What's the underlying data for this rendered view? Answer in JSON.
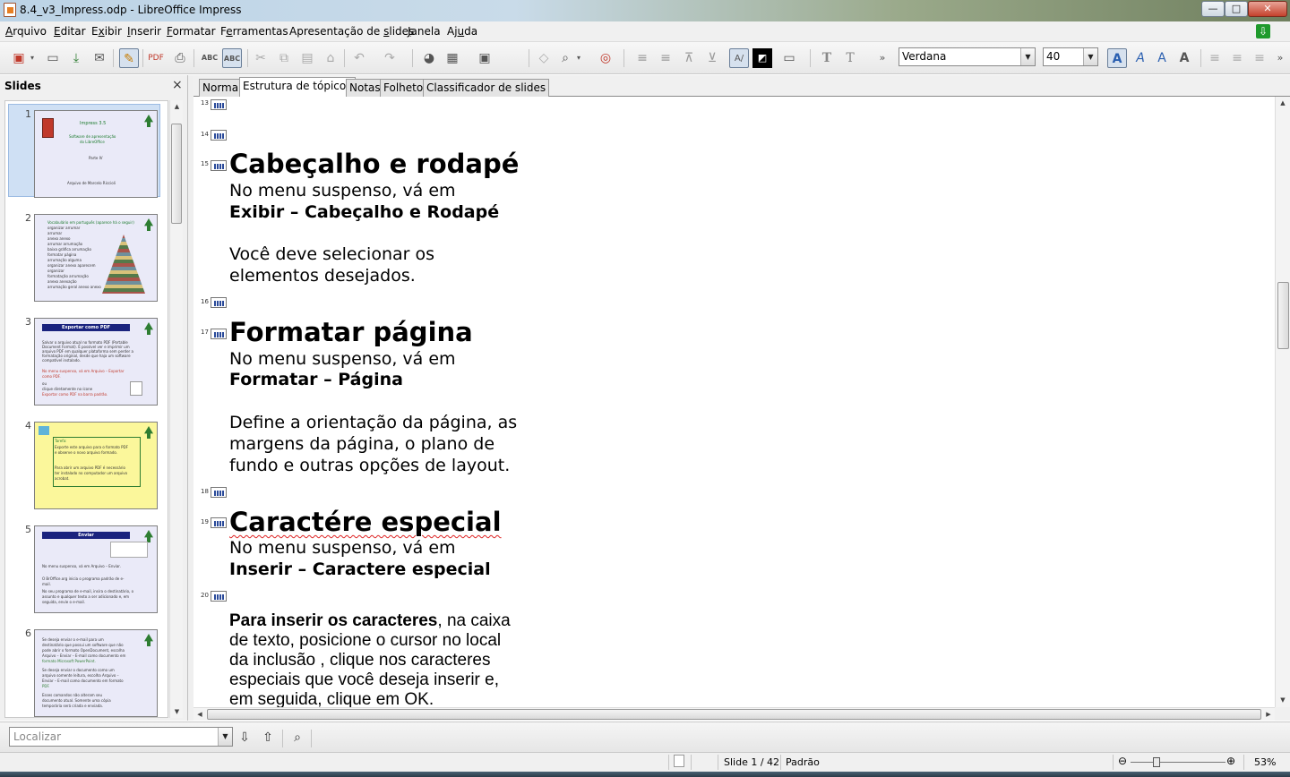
{
  "window": {
    "title": "8.4_v3_Impress.odp - LibreOffice Impress",
    "min_glyph": "—",
    "max_glyph": "□",
    "close_glyph": "✕"
  },
  "menu": [
    {
      "pre": "",
      "key": "A",
      "post": "rquivo"
    },
    {
      "pre": "",
      "key": "E",
      "post": "ditar"
    },
    {
      "pre": "E",
      "key": "x",
      "post": "ibir"
    },
    {
      "pre": "",
      "key": "I",
      "post": "nserir"
    },
    {
      "pre": "",
      "key": "F",
      "post": "ormatar"
    },
    {
      "pre": "F",
      "key": "e",
      "post": "rramentas"
    },
    {
      "pre": "Apresentação de ",
      "key": "s",
      "post": "lides"
    },
    {
      "pre": "",
      "key": "J",
      "post": "anela"
    },
    {
      "pre": "Aj",
      "key": "u",
      "post": "da"
    }
  ],
  "toolbar": {
    "font_name": "Verdana",
    "font_size": "40"
  },
  "slides_pane": {
    "title": "Slides",
    "close": "×",
    "slides": [
      {
        "num": "1",
        "bar": "",
        "lines": [
          "Impress 3.5",
          "Software de apresentação",
          "do LibreOffice",
          "Parte IV",
          "Arquivo de Marcelo Riccioli"
        ]
      },
      {
        "num": "2",
        "bar": "",
        "lines": [
          "Vocabulário em português (aparece há o seguir)",
          "organizar arrumar",
          "arrumar",
          "anexo anexo",
          "arrumar arrumação",
          "baixa gráfica arrumação",
          "formatar página",
          "arrumação alguma",
          "organizar anexo aparecem",
          "organizar",
          "formatação arrumação",
          "anexo anexação",
          "arrumação geral anexo anexo"
        ]
      },
      {
        "num": "3",
        "bar": "Exportar como PDF",
        "lines": [
          "Salvar o arquivo atual no formato PDF (Portable",
          "Document Format). É possível ver e imprimir um",
          "arquivo PDF em qualquer plataforma sem perder a",
          "formatação original, desde que haja um software",
          "compatível instalado.",
          "No menu suspenso, vá em Arquivo – Exportar",
          "como PDF.",
          "ou",
          "clique diretamente no ícone",
          "Exportar como PDF na barra padrão."
        ]
      },
      {
        "num": "4",
        "bar": "",
        "lines": [
          "Tarefa:",
          "Exporte este arquivo para o formato PDF",
          "e observe o novo arquivo formado.",
          "Para abrir um arquivo PDF é necessário",
          "ter instalado no computador um arquivo",
          "acrobat."
        ]
      },
      {
        "num": "5",
        "bar": "Enviar",
        "lines": [
          "No menu suspenso, vá em Arquivo – Enviar.",
          "O BrOffice.org inicia o programa padrão de e-",
          "mail.",
          "No seu programa de e-mail, insira o destinatário, o",
          "assunto e qualquer texto a ser adicionado e, em",
          "seguida, envie o e-mail."
        ]
      },
      {
        "num": "6",
        "bar": "",
        "lines": [
          "Se deseja enviar o e-mail para um",
          "destinatário que possui um software que não",
          "pode abrir o formato OpenDocument, escolha",
          "Arquivo – Enviar – E-mail como documento em",
          "formato Microsoft PowerPoint.",
          "Se deseja enviar o documento como um",
          "arquivo somente leitura, escolha Arquivo –",
          "Enviar – E-mail como documento em formato",
          "PDF.",
          "Esses comandos não alteram seu",
          "documento atual. Somente uma cópia",
          "temporária será criada e enviada."
        ]
      }
    ]
  },
  "tabs": [
    "Normal",
    "Estrutura de tópicos",
    "Notas",
    "Folheto",
    "Classificador de slides"
  ],
  "active_tab": "Estrutura de tópicos",
  "outline": {
    "n13": "13",
    "n14": "14",
    "n15": "15",
    "s15_title": "Cabeçalho e rodapé",
    "s15_l1": "No menu suspenso, vá  em",
    "s15_l2": "Exibir – Cabeçalho e Rodapé",
    "s15_l3": "Você deve selecionar os",
    "s15_l4": "elementos desejados.",
    "n16": "16",
    "n17": "17",
    "s17_title": "Formatar página",
    "s17_l1": "No menu suspenso, vá  em",
    "s17_l2": "Formatar – Página",
    "s17_l3": "Define a orientação da página, as",
    "s17_l4": "margens da página, o plano de",
    "s17_l5": "fundo e outras opções de layout.",
    "n18": "18",
    "n19": "19",
    "s19_title": "Caractére especial",
    "s19_l1": "No menu suspenso, vá  em",
    "s19_l2": "Inserir – Caractere especial",
    "n20": "20",
    "s20_bold": "Para inserir os caracteres",
    "s20_l1_rest": ", na caixa",
    "s20_l2": "de texto, posicione o cursor no local",
    "s20_l3": "da inclusão , clique nos caracteres",
    "s20_l4": "especiais que você deseja inserir e,",
    "s20_l5": "em seguida, clique em OK."
  },
  "findbar": {
    "placeholder": "Localizar"
  },
  "statusbar": {
    "slide": "Slide 1 / 42",
    "layout": "Padrão",
    "zoom_minus": "⊖",
    "zoom_plus": "⊕",
    "zoom": "53%",
    "zoom_level_fraction": 0.27
  },
  "colors": {
    "accent": "#1a237e",
    "slide_bg": "#eaeaf8",
    "task_slide_bg": "#fbf79b"
  }
}
